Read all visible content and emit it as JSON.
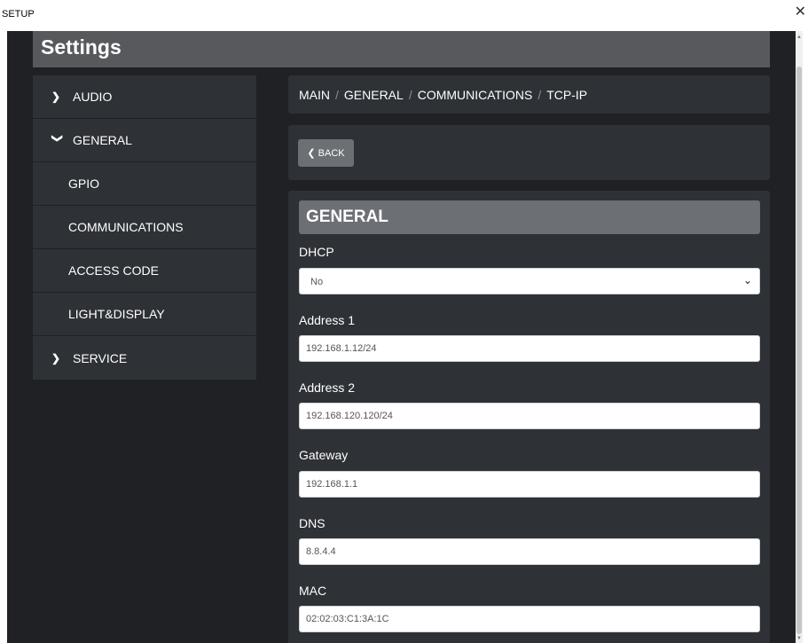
{
  "window": {
    "title": "SETUP",
    "close_glyph": "✕"
  },
  "header": {
    "title": "Settings"
  },
  "sidebar": {
    "items": [
      {
        "label": "AUDIO",
        "icon": "chevron-right-icon",
        "glyph": "❯"
      },
      {
        "label": "GENERAL",
        "icon": "chevron-down-icon",
        "glyph": "❯"
      },
      {
        "label": "GPIO"
      },
      {
        "label": "COMMUNICATIONS"
      },
      {
        "label": "ACCESS CODE"
      },
      {
        "label": "LIGHT&DISPLAY"
      },
      {
        "label": "SERVICE",
        "icon": "chevron-right-icon",
        "glyph": "❯"
      }
    ]
  },
  "breadcrumb": {
    "items": [
      "MAIN",
      "GENERAL",
      "COMMUNICATIONS",
      "TCP-IP"
    ],
    "separator": "/"
  },
  "back_button": {
    "label": "❮ BACK"
  },
  "form": {
    "section_title": "GENERAL",
    "dhcp": {
      "label": "DHCP",
      "value": "No",
      "caret": "⌄"
    },
    "address1": {
      "label": "Address 1",
      "value": "192.168.1.12/24"
    },
    "address2": {
      "label": "Address 2",
      "value": "192.168.120.120/24"
    },
    "gateway": {
      "label": "Gateway",
      "value": "192.168.1.1"
    },
    "dns": {
      "label": "DNS",
      "value": "8.8.4.4"
    },
    "mac": {
      "label": "MAC",
      "value": "02:02:03:C1:3A:1C"
    }
  },
  "colors": {
    "background": "#1f2124",
    "card": "#2e3136",
    "header": "#58595c",
    "section_title": "#6c6f74",
    "text": "#ffffff"
  }
}
